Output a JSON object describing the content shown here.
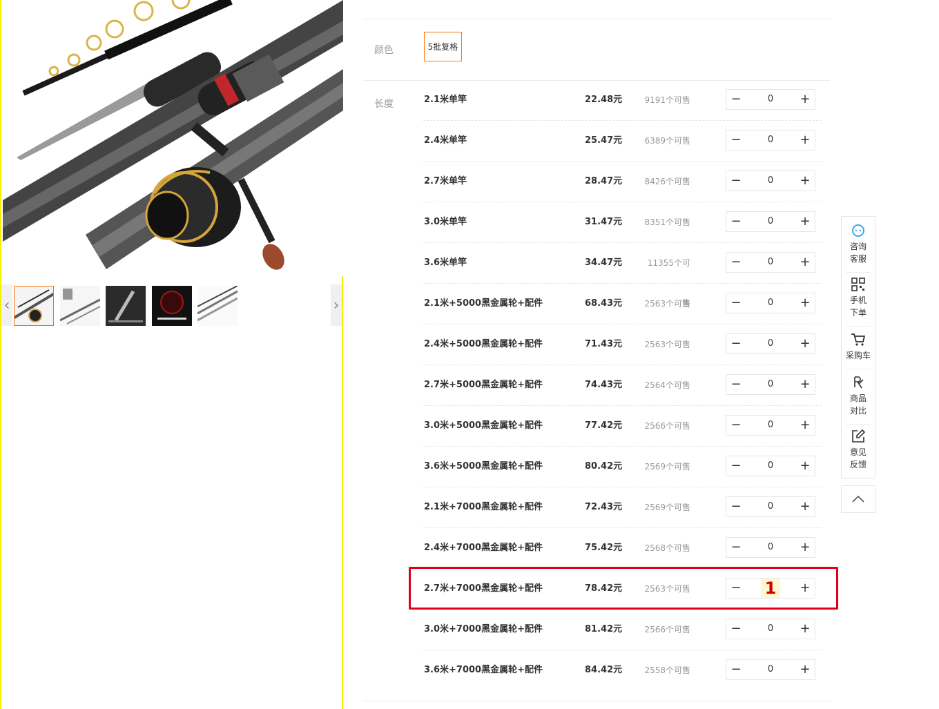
{
  "gallery": {
    "main_image": "fishing-rod-and-spinning-reel",
    "thumbnails": [
      "rod-and-reel",
      "rod-parts",
      "rod-tip-closeup",
      "reel-dark-promo",
      "rod-sections"
    ],
    "active_thumbnail": 0,
    "accent_color": "#ff7300",
    "frame_color": "#f5ef00"
  },
  "attributes": {
    "color_label": "颜色",
    "color_option": "5批复格",
    "length_label": "长度"
  },
  "skus": [
    {
      "name": "2.1米单竿",
      "price": "22.48元",
      "stock": "9191个可售",
      "qty": "0"
    },
    {
      "name": "2.4米单竿",
      "price": "25.47元",
      "stock": "6389个可售",
      "qty": "0"
    },
    {
      "name": "2.7米单竿",
      "price": "28.47元",
      "stock": "8426个可售",
      "qty": "0"
    },
    {
      "name": "3.0米单竿",
      "price": "31.47元",
      "stock": "8351个可售",
      "qty": "0"
    },
    {
      "name": "3.6米单竿",
      "price": "34.47元",
      "stock": "11355个可售",
      "qty": "0"
    },
    {
      "name": "2.1米+5000黑金属轮+配件",
      "price": "68.43元",
      "stock": "2563个可售",
      "qty": "0"
    },
    {
      "name": "2.4米+5000黑金属轮+配件",
      "price": "71.43元",
      "stock": "2563个可售",
      "qty": "0"
    },
    {
      "name": "2.7米+5000黑金属轮+配件",
      "price": "74.43元",
      "stock": "2564个可售",
      "qty": "0"
    },
    {
      "name": "3.0米+5000黑金属轮+配件",
      "price": "77.42元",
      "stock": "2566个可售",
      "qty": "0"
    },
    {
      "name": "3.6米+5000黑金属轮+配件",
      "price": "80.42元",
      "stock": "2569个可售",
      "qty": "0"
    },
    {
      "name": "2.1米+7000黑金属轮+配件",
      "price": "72.43元",
      "stock": "2569个可售",
      "qty": "0"
    },
    {
      "name": "2.4米+7000黑金属轮+配件",
      "price": "75.42元",
      "stock": "2568个可售",
      "qty": "0"
    },
    {
      "name": "2.7米+7000黑金属轮+配件",
      "price": "78.42元",
      "stock": "2563个可售",
      "qty": "1"
    },
    {
      "name": "3.0米+7000黑金属轮+配件",
      "price": "81.42元",
      "stock": "2566个可售",
      "qty": "0"
    },
    {
      "name": "3.6米+7000黑金属轮+配件",
      "price": "84.42元",
      "stock": "2558个可售",
      "qty": "0"
    }
  ],
  "highlight_color": "#e0001a",
  "stepper": {
    "minus": "−",
    "plus": "+"
  },
  "sidebar": {
    "consult": "咨询客服",
    "mobile_order": "手机下单",
    "cart": "采购车",
    "compare": "商品对比",
    "feedback": "意见反馈",
    "consult_icon_color": "#3aa8e8"
  }
}
